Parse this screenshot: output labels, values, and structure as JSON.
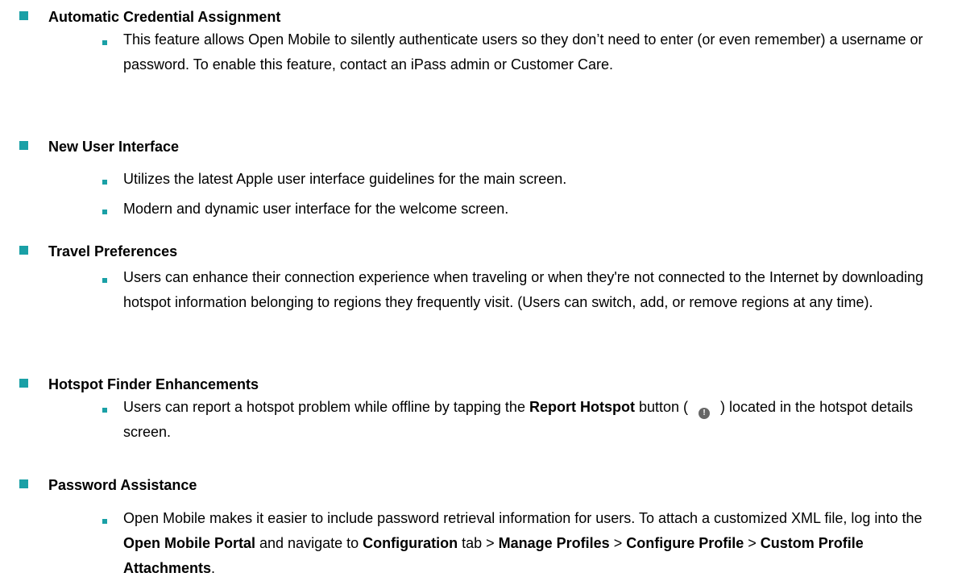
{
  "colors": {
    "accent": "#1aa0a6"
  },
  "sections": [
    {
      "title": "Automatic Credential Assignment",
      "bullets": [
        [
          {
            "t": "This feature allows Open Mobile to silently authenticate users so they don’t need to enter (or even remember) a username or password. To enable this feature, contact an iPass admin or Customer Care."
          }
        ]
      ]
    },
    {
      "title": "New User Interface",
      "bullets": [
        [
          {
            "t": "Utilizes the latest Apple user interface guidelines for the main screen."
          }
        ],
        [
          {
            "t": "Modern and dynamic user interface for the welcome screen."
          }
        ]
      ]
    },
    {
      "title": "Travel Preferences",
      "bullets": [
        [
          {
            "t": "Users can enhance their connection experience when traveling or when they're not connected to the Internet by downloading hotspot information belonging to regions they frequently visit. (Users can switch, add, or remove regions at any time)."
          }
        ]
      ]
    },
    {
      "title": "Hotspot Finder Enhancements",
      "bullets": [
        [
          {
            "t": "Users can report a hotspot problem while offline by tapping the "
          },
          {
            "t": "Report Hotspot",
            "b": true
          },
          {
            "t": " button ("
          },
          {
            "icon": "report-hotspot-icon"
          },
          {
            "t": ") located in the hotspot details screen."
          }
        ]
      ]
    },
    {
      "title": "Password Assistance",
      "bullets": [
        [
          {
            "t": "Open Mobile makes it easier to include password retrieval information for users. To attach a customized XML file, log into the "
          },
          {
            "t": "Open Mobile Portal",
            "b": true
          },
          {
            "t": " and navigate to "
          },
          {
            "t": "Configuration",
            "b": true
          },
          {
            "t": " tab > "
          },
          {
            "t": "Manage Profiles",
            "b": true
          },
          {
            "t": " > "
          },
          {
            "t": "Configure Profile",
            "b": true
          },
          {
            "t": " > "
          },
          {
            "t": "Custom Profile Attachments",
            "b": true
          },
          {
            "t": "."
          }
        ]
      ]
    }
  ]
}
